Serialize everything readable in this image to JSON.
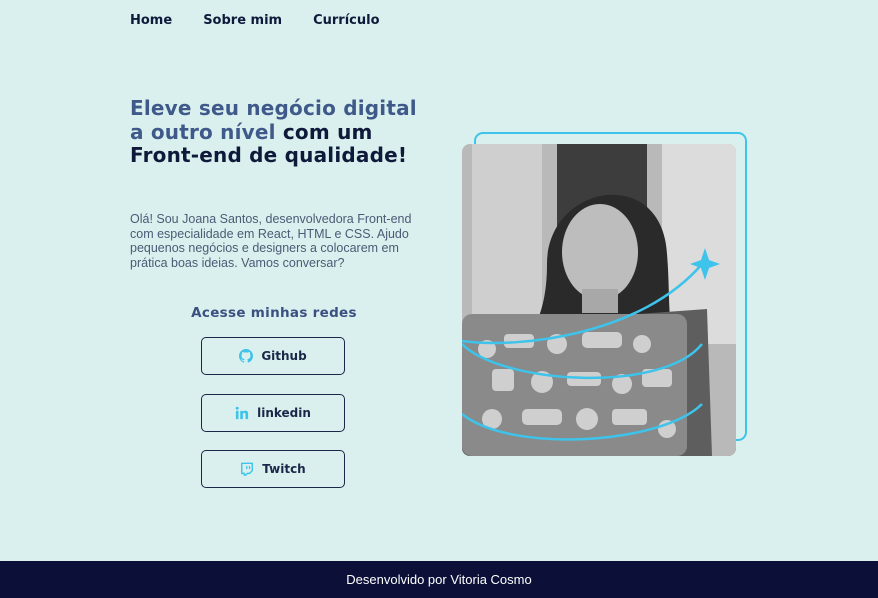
{
  "nav": {
    "items": [
      "Home",
      "Sobre mim",
      "Currículo"
    ]
  },
  "hero": {
    "headline_accent": "Eleve seu negócio digital a outro nível",
    "headline_rest": " com um Front-end de qualidade!",
    "intro": "Olá! Sou Joana Santos, desenvolvedora Front-end com especialidade em React, HTML e CSS. Ajudo pequenos negócios e designers a colocarem em prática boas ideias. Vamos conversar?",
    "social_title": "Acesse minhas redes"
  },
  "social": [
    {
      "label": "Github",
      "icon": "github-icon"
    },
    {
      "label": "linkedin",
      "icon": "linkedin-icon"
    },
    {
      "label": "Twitch",
      "icon": "twitch-icon"
    }
  ],
  "photo": {
    "alt": ""
  },
  "footer": {
    "text": "Desenvolvido por Vitoria Cosmo"
  },
  "colors": {
    "background": "#daf0ee",
    "accent": "#3ec3ea",
    "dark": "#0c1038",
    "headline_accent": "#3f5a8a"
  }
}
